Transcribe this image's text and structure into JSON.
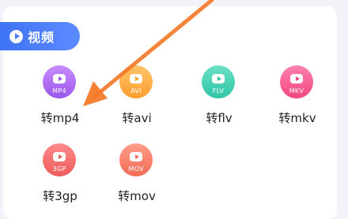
{
  "section": {
    "title": "视频",
    "icon": "play-circle-icon"
  },
  "tools": [
    {
      "id": "mp4",
      "format": "MP4",
      "label": "转mp4",
      "color_top": "#c98cff",
      "color_bottom": "#9a56ea",
      "icon": "video-play-icon"
    },
    {
      "id": "avi",
      "format": "AVI",
      "label": "转avi",
      "color_top": "#ffc36a",
      "color_bottom": "#ff9f2e",
      "icon": "video-play-icon"
    },
    {
      "id": "flv",
      "format": "FLV",
      "label": "转flv",
      "color_top": "#6be0c6",
      "color_bottom": "#2fc5a6",
      "icon": "video-play-icon"
    },
    {
      "id": "mkv",
      "format": "MKV",
      "label": "转mkv",
      "color_top": "#ff7fb0",
      "color_bottom": "#f2477f",
      "icon": "video-play-icon"
    },
    {
      "id": "3gp",
      "format": "3GP",
      "label": "转3gp",
      "color_top": "#ff8b8b",
      "color_bottom": "#ef5b5b",
      "icon": "video-play-icon"
    },
    {
      "id": "mov",
      "format": "MOV",
      "label": "转mov",
      "color_top": "#ff9d8a",
      "color_bottom": "#f26b56",
      "icon": "video-play-icon"
    }
  ],
  "annotation": {
    "color": "#f47a2a",
    "icon": "arrow-pointer-icon"
  }
}
